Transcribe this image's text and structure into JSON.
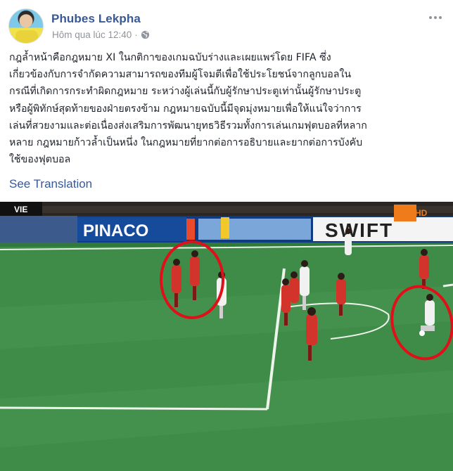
{
  "post": {
    "author": "Phubes Lekpha",
    "timestamp": "Hôm qua lúc 12:40",
    "separator": "·",
    "privacy_icon": "globe-icon",
    "menu_icon": "more-options-icon",
    "text_lines": [
      "กฎล้ำหน้าคือกฎหมาย XI ในกติกาของเกมฉบับร่างและเผยแพร่โดย FIFA ซึ่ง",
      "เกี่ยวข้องกับการจำกัดความสามารถของทีมผู้โจมตีเพื่อใช้ประโยชน์จากลูกบอลใน",
      "กรณีที่เกิดการกระทำผิดกฎหมาย ระหว่างผู้เล่นนี้กับผู้รักษาประตูเท่านั้นผู้รักษาประตู",
      "หรือผู้พิทักษ์สุดท้ายของฝ่ายตรงข้าม กฎหมายฉบับนี้มีจุดมุ่งหมายเพื่อให้แน่ใจว่าการ",
      "เล่นที่สวยงามและต่อเนื่องส่งเสริมการพัฒนายุทธวิธีรวมทั้งการเล่นเกมฟุตบอลที่หลาก",
      "หลาย กฎหมายก้าวล้ำเป็นหนึ่ง ในกฎหมายที่ยากต่อการอธิบายและยากต่อการบังคับ",
      "ใช้ของฟุตบอล"
    ],
    "see_translation": "See Translation"
  },
  "photo": {
    "score_tag": "VIE",
    "boards": [
      "PINACO",
      "SWIFT"
    ],
    "small_board": "HD",
    "colors": {
      "grass": "#3f8c48",
      "grass_stripe": "#47964f",
      "circle": "#e0101a",
      "team_red": "#d2332b",
      "team_white": "#f1f1f1"
    }
  }
}
